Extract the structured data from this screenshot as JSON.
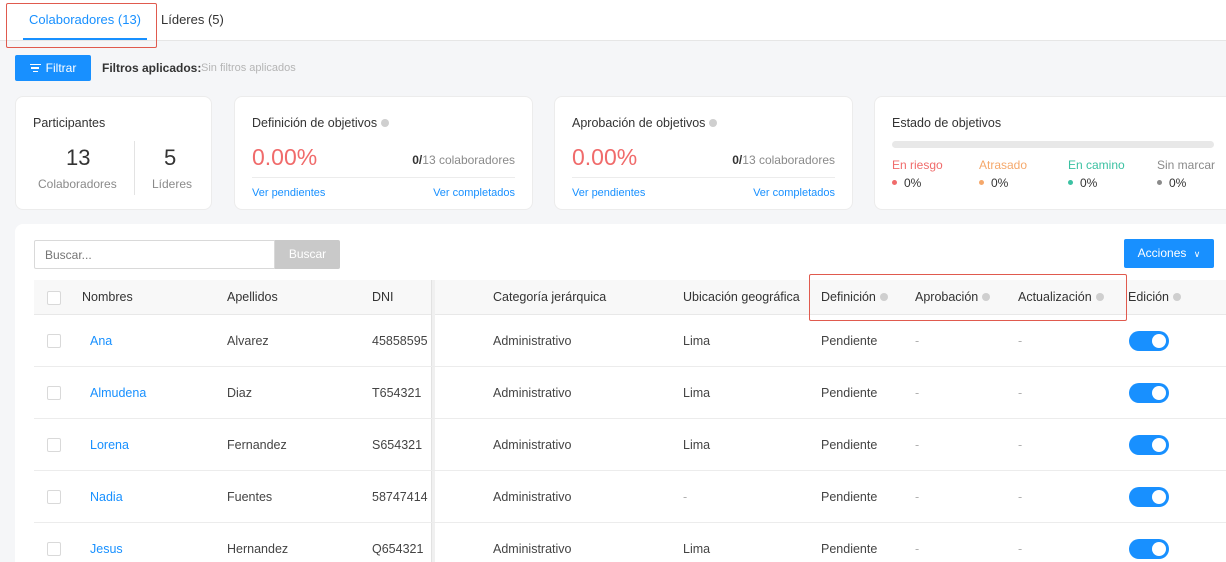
{
  "tabs": [
    {
      "label": "Colaboradores (13)",
      "active": true
    },
    {
      "label": "Líderes (5)",
      "active": false
    }
  ],
  "filter": {
    "button_label": "Filtrar",
    "applied_label": "Filtros aplicados:",
    "applied_value": "Sin filtros aplicados"
  },
  "participants": {
    "title": "Participantes",
    "collaborators_count": "13",
    "collaborators_label": "Colaboradores",
    "leaders_count": "5",
    "leaders_label": "Líderes"
  },
  "definition_card": {
    "title": "Definición de objetivos",
    "percent": "0.00%",
    "ratio_num": "0/",
    "ratio_rest": "13 colaboradores",
    "pending_link": "Ver pendientes",
    "completed_link": "Ver completados"
  },
  "approval_card": {
    "title": "Aprobación de objetivos",
    "percent": "0.00%",
    "ratio_num": "0/",
    "ratio_rest": "13 colaboradores",
    "pending_link": "Ver pendientes",
    "completed_link": "Ver completados"
  },
  "status_card": {
    "title": "Estado de objetivos",
    "items": [
      {
        "label": "En riesgo",
        "value": "0%",
        "color": "#f06b6b"
      },
      {
        "label": "Atrasado",
        "value": "0%",
        "color": "#f5a86b"
      },
      {
        "label": "En camino",
        "value": "0%",
        "color": "#3bc1a2"
      },
      {
        "label": "Sin marcar",
        "value": "0%",
        "color": "#8a8a8a"
      }
    ]
  },
  "table_tools": {
    "search_placeholder": "Buscar...",
    "search_button": "Buscar",
    "actions_button": "Acciones",
    "actions_chevron": "∨"
  },
  "table": {
    "headers": {
      "nombres": "Nombres",
      "apellidos": "Apellidos",
      "dni": "DNI",
      "categoria": "Categoría jerárquica",
      "ubicacion": "Ubicación geográfica",
      "definicion": "Definición",
      "aprobacion": "Aprobación",
      "actualizacion": "Actualización",
      "edicion": "Edición"
    },
    "rows": [
      {
        "nombre": "Ana",
        "apellido": "Alvarez",
        "dni": "45858595",
        "categoria": "Administrativo",
        "ubicacion": "Lima",
        "definicion": "Pendiente",
        "aprobacion": "-",
        "actualizacion": "-",
        "edicion": true
      },
      {
        "nombre": "Almudena",
        "apellido": "Diaz",
        "dni": "T654321",
        "categoria": "Administrativo",
        "ubicacion": "Lima",
        "definicion": "Pendiente",
        "aprobacion": "-",
        "actualizacion": "-",
        "edicion": true
      },
      {
        "nombre": "Lorena",
        "apellido": "Fernandez",
        "dni": "S654321",
        "categoria": "Administrativo",
        "ubicacion": "Lima",
        "definicion": "Pendiente",
        "aprobacion": "-",
        "actualizacion": "-",
        "edicion": true
      },
      {
        "nombre": "Nadia",
        "apellido": "Fuentes",
        "dni": "58747414",
        "categoria": "Administrativo",
        "ubicacion": "-",
        "definicion": "Pendiente",
        "aprobacion": "-",
        "actualizacion": "-",
        "edicion": true
      },
      {
        "nombre": "Jesus",
        "apellido": "Hernandez",
        "dni": "Q654321",
        "categoria": "Administrativo",
        "ubicacion": "Lima",
        "definicion": "Pendiente",
        "aprobacion": "-",
        "actualizacion": "-",
        "edicion": true
      }
    ]
  },
  "colors": {
    "accent": "#1890ff",
    "danger": "#f06b6b",
    "highlight_box": "#e05a4e"
  }
}
